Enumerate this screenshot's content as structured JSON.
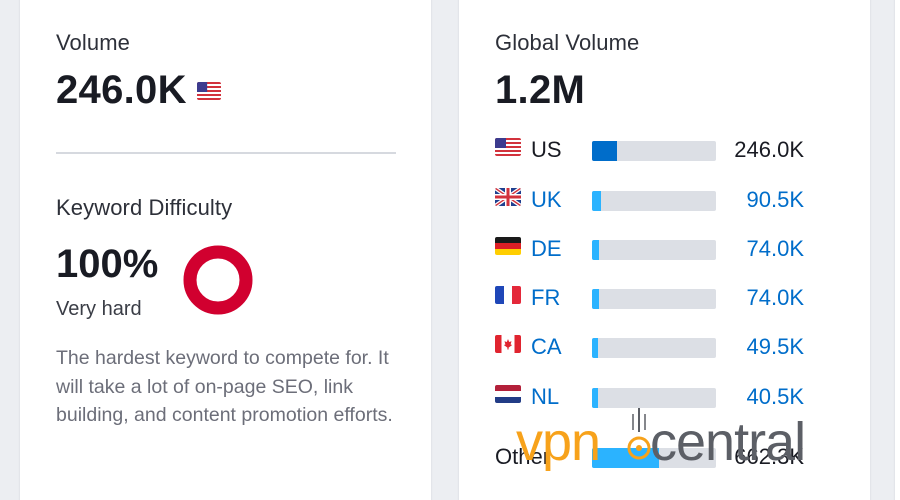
{
  "volume": {
    "label": "Volume",
    "value": "246.0K",
    "flag_icon": "us-flag-icon"
  },
  "keyword_difficulty": {
    "label": "Keyword Difficulty",
    "percent_text": "100%",
    "percent": 100,
    "level": "Very hard",
    "description": "The hardest keyword to compete for. It will take a lot of on-page SEO, link building, and content promotion efforts.",
    "ring_color": "#d1002f"
  },
  "global_volume": {
    "label": "Global Volume",
    "value": "1.2M",
    "countries": [
      {
        "code": "US",
        "flag": "us-flag-icon",
        "value": "246.0K",
        "share": 0.2,
        "link": false
      },
      {
        "code": "UK",
        "flag": "uk-flag-icon",
        "value": "90.5K",
        "share": 0.075,
        "link": true
      },
      {
        "code": "DE",
        "flag": "de-flag-icon",
        "value": "74.0K",
        "share": 0.06,
        "link": true
      },
      {
        "code": "FR",
        "flag": "fr-flag-icon",
        "value": "74.0K",
        "share": 0.06,
        "link": true
      },
      {
        "code": "CA",
        "flag": "ca-flag-icon",
        "value": "49.5K",
        "share": 0.04,
        "link": true
      },
      {
        "code": "NL",
        "flag": "nl-flag-icon",
        "value": "40.5K",
        "share": 0.035,
        "link": true
      },
      {
        "code": "Other",
        "flag": "",
        "value": "662.3K",
        "share": 0.54,
        "link": false
      }
    ]
  },
  "watermark": {
    "text_left": "vpn",
    "text_right": "central"
  },
  "colors": {
    "bar_primary": "#006dca",
    "bar_light": "#2bb3ff",
    "link": "#006dca",
    "text": "#191b23",
    "watermark_orange": "#f7a21b",
    "watermark_gray": "#5c5f66"
  }
}
